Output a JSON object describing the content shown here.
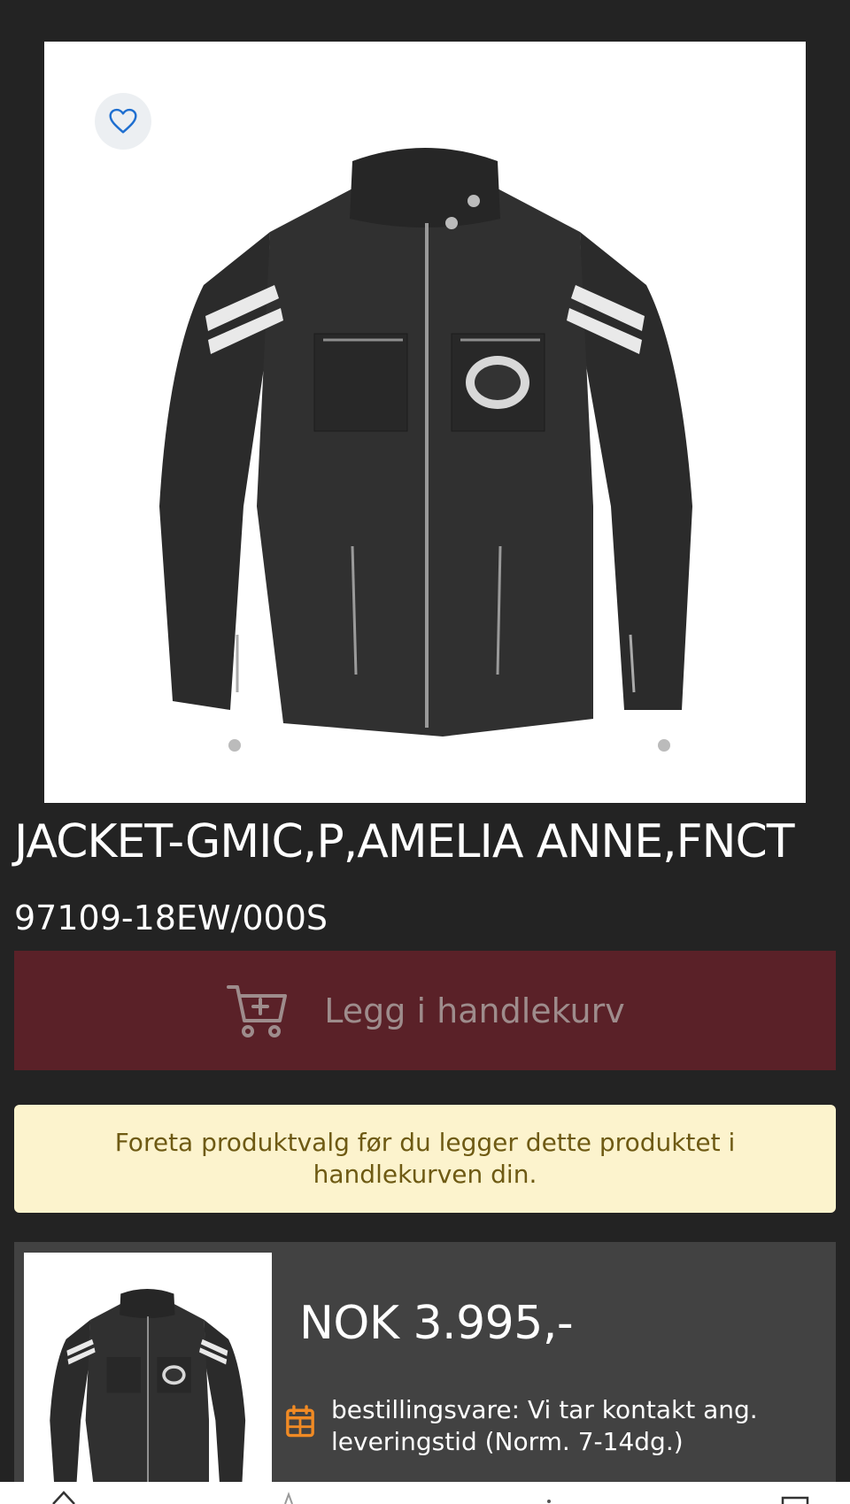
{
  "product": {
    "title": "JACKET-GMIC,P,AMELIA ANNE,FNCT",
    "sku": "97109-18EW/000S",
    "image_alt": "Black jacket with white sleeve stripes"
  },
  "cart": {
    "button_label": "Legg i handlekurv"
  },
  "notice": {
    "text": "Foreta produktvalg før du legger dette produktet i handlekurven din."
  },
  "price_card": {
    "price": "NOK 3.995,-",
    "availability": "bestillingsvare: Vi tar kontakt ang. leveringstid (Norm. 7-14dg.)"
  },
  "colors": {
    "background": "#232323",
    "cart_button": "#5a2128",
    "notice_bg": "#fcf3cd",
    "card_bg": "#424242",
    "favorite_icon": "#1f6fd0",
    "availability_icon": "#f08a24"
  },
  "icons": [
    "heart-icon",
    "cart-plus-icon",
    "calendar-icon"
  ]
}
